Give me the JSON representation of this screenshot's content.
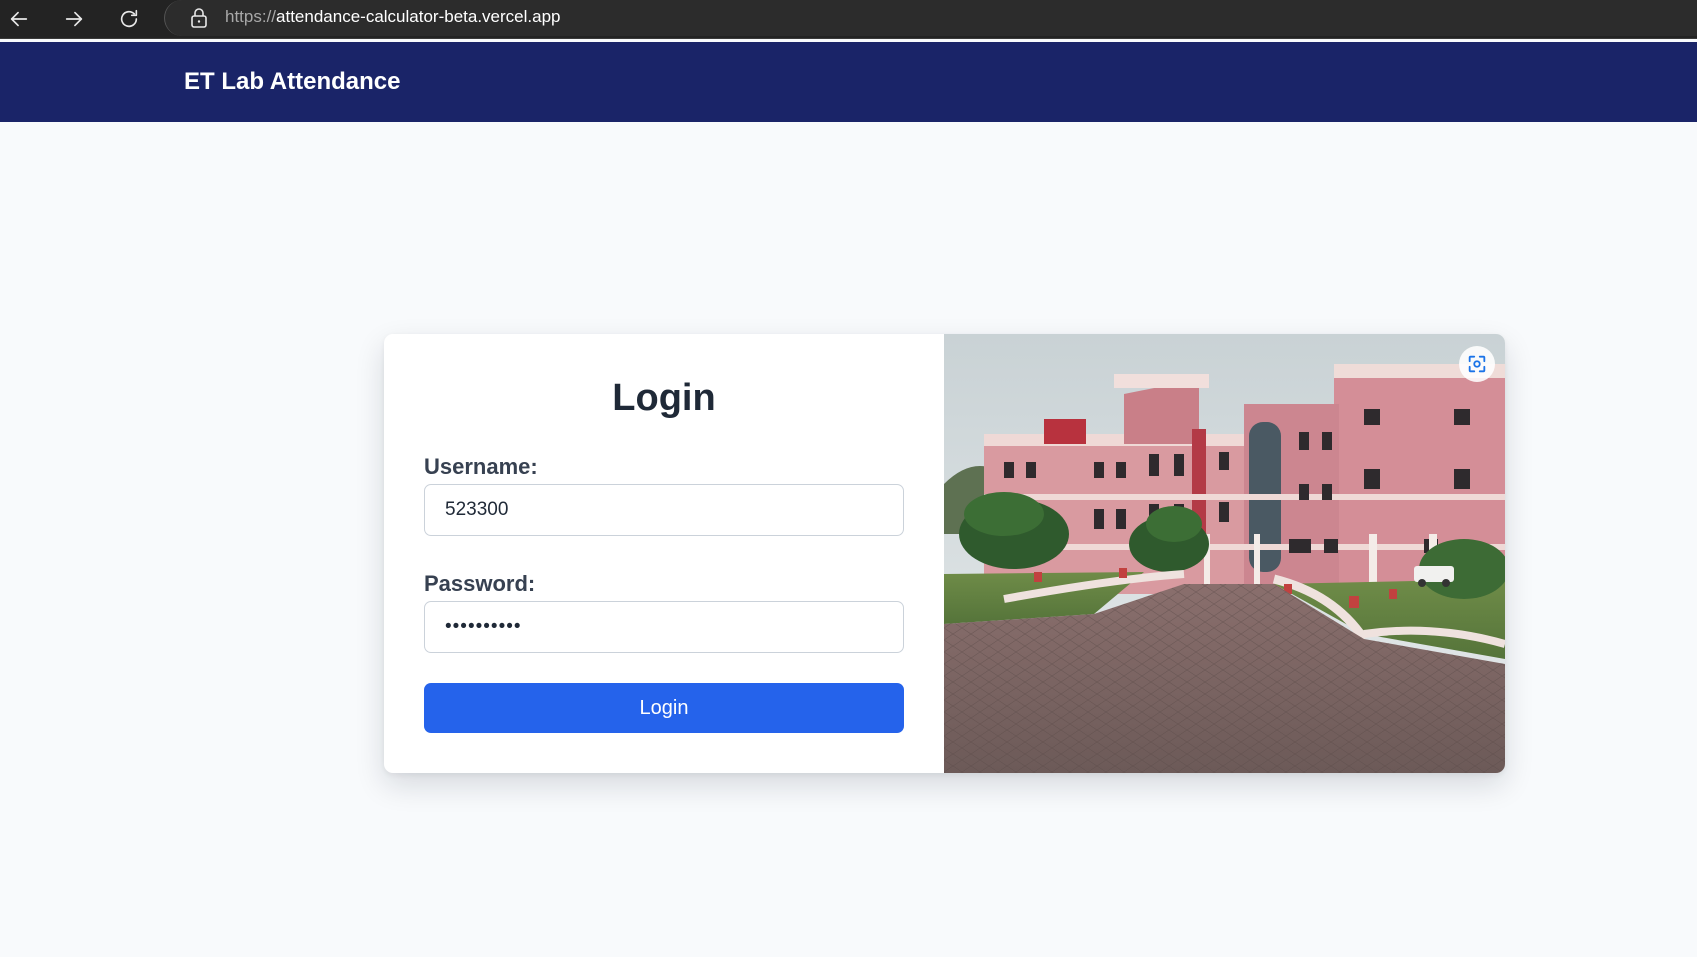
{
  "browser": {
    "url_scheme": "https://",
    "url_host": "attendance-calculator-beta.vercel.app",
    "icons": [
      "back-arrow-icon",
      "forward-arrow-icon",
      "reload-icon",
      "lock-icon"
    ]
  },
  "header": {
    "title": "ET Lab Attendance",
    "background_color": "#1a2468"
  },
  "login": {
    "heading": "Login",
    "username_label": "Username:",
    "username_value": "523300",
    "password_label": "Password:",
    "password_value": "••••••••••",
    "submit_label": "Login",
    "accent_color": "#2563eb"
  },
  "image": {
    "subject": "campus-building-photo",
    "overlay_icon": "visual-search-icon"
  }
}
